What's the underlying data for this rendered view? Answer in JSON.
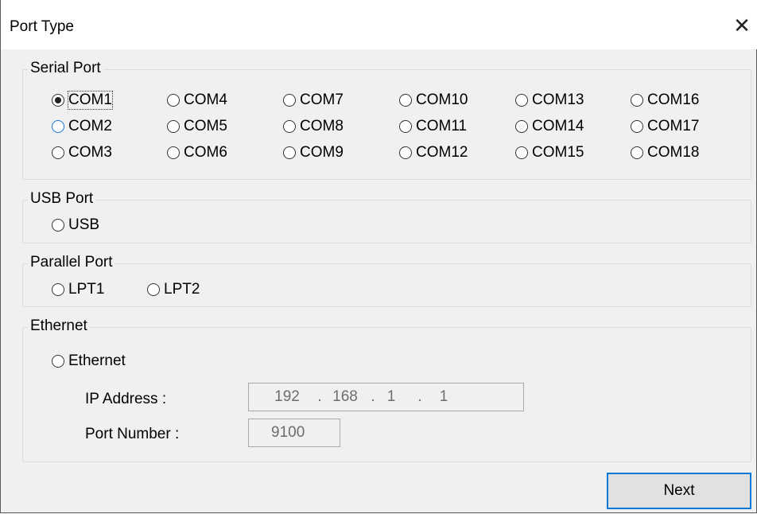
{
  "window": {
    "title": "Port Type",
    "close_glyph": "✕"
  },
  "serial": {
    "legend": "Serial Port",
    "ports": [
      {
        "label": "COM1",
        "checked": true
      },
      {
        "label": "COM4"
      },
      {
        "label": "COM7"
      },
      {
        "label": "COM10"
      },
      {
        "label": "COM13"
      },
      {
        "label": "COM16"
      },
      {
        "label": "COM2",
        "focus": true
      },
      {
        "label": "COM5"
      },
      {
        "label": "COM8"
      },
      {
        "label": "COM11"
      },
      {
        "label": "COM14"
      },
      {
        "label": "COM17"
      },
      {
        "label": "COM3"
      },
      {
        "label": "COM6"
      },
      {
        "label": "COM9"
      },
      {
        "label": "COM12"
      },
      {
        "label": "COM15"
      },
      {
        "label": "COM18"
      }
    ]
  },
  "usb": {
    "legend": "USB Port",
    "label": "USB"
  },
  "parallel": {
    "legend": "Parallel Port",
    "ports": [
      {
        "label": "LPT1"
      },
      {
        "label": "LPT2"
      }
    ]
  },
  "ethernet": {
    "legend": "Ethernet",
    "label": "Ethernet",
    "ip_label": "IP Address :",
    "ip": [
      "192",
      "168",
      "1",
      "1"
    ],
    "port_label": "Port Number :",
    "port_value": "9100"
  },
  "buttons": {
    "next": "Next"
  }
}
